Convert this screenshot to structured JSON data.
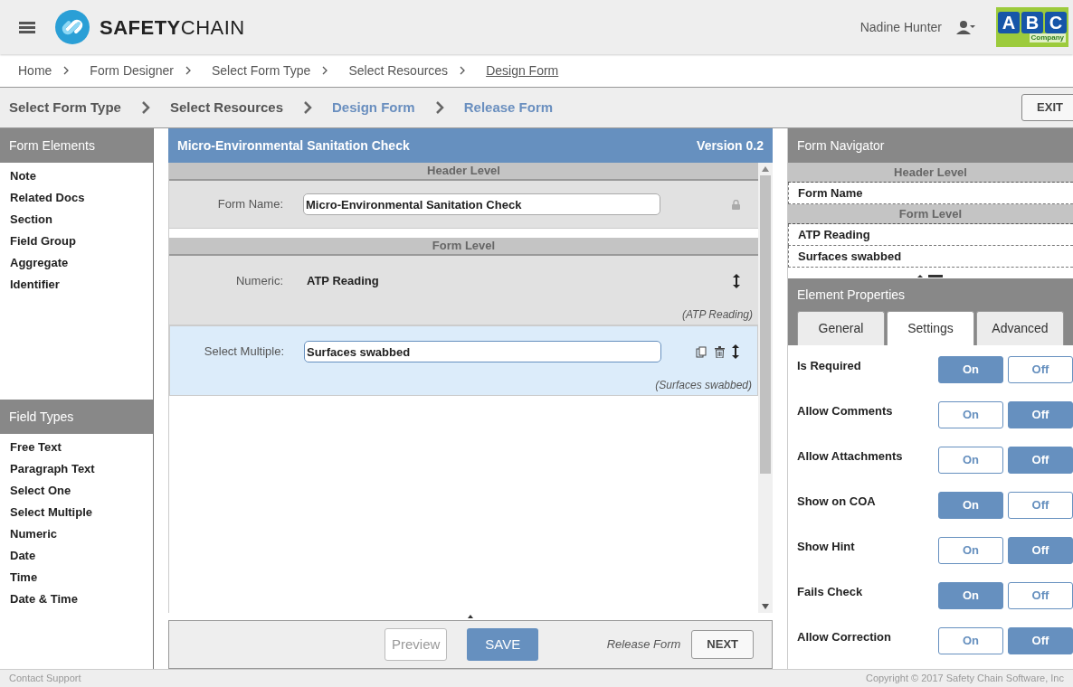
{
  "header": {
    "brand_bold": "SAFETY",
    "brand_light": "CHAIN",
    "user": "Nadine Hunter",
    "company_logo": {
      "letters": [
        "A",
        "B",
        "C"
      ],
      "caption": "Company"
    }
  },
  "breadcrumb": [
    {
      "label": "Home",
      "current": false
    },
    {
      "label": "Form Designer",
      "current": false
    },
    {
      "label": "Select Form Type",
      "current": false
    },
    {
      "label": "Select Resources",
      "current": false
    },
    {
      "label": "Design Form",
      "current": true
    }
  ],
  "wizard": {
    "steps": [
      {
        "label": "Select Form Type",
        "kind": "done"
      },
      {
        "label": "Select Resources",
        "kind": "done"
      },
      {
        "label": "Design Form",
        "kind": "upcoming"
      },
      {
        "label": "Release Form",
        "kind": "upcoming"
      }
    ],
    "exit": "EXIT"
  },
  "form_elements": {
    "title": "Form Elements",
    "items": [
      "Note",
      "Related Docs",
      "Section",
      "Field Group",
      "Aggregate",
      "Identifier"
    ]
  },
  "field_types": {
    "title": "Field Types",
    "items": [
      "Free Text",
      "Paragraph Text",
      "Select One",
      "Select Multiple",
      "Numeric",
      "Date",
      "Time",
      "Date & Time"
    ]
  },
  "form": {
    "title": "Micro-Environmental Sanitation Check",
    "version": "Version 0.2",
    "sections": [
      {
        "title": "Header Level",
        "rows": [
          {
            "label": "Form Name:",
            "kind": "input",
            "value": "Micro-Environmental Sanitation Check",
            "locked": true,
            "selected": false
          }
        ]
      },
      {
        "title": "Form Level",
        "rows": [
          {
            "label": "Numeric:",
            "kind": "text",
            "value": "ATP Reading",
            "hint": "(ATP Reading)",
            "locked": false,
            "selected": false
          },
          {
            "label": "Select Multiple:",
            "kind": "input",
            "value": "Surfaces swabbed",
            "hint": "(Surfaces swabbed)",
            "locked": false,
            "selected": true
          }
        ]
      }
    ]
  },
  "footer_bar": {
    "preview": "Preview",
    "save": "SAVE",
    "release_label": "Release Form",
    "next": "NEXT"
  },
  "navigator": {
    "title": "Form Navigator",
    "sections": [
      {
        "title": "Header Level",
        "items": [
          "Form Name"
        ]
      },
      {
        "title": "Form Level",
        "items": [
          "ATP Reading",
          "Surfaces swabbed"
        ]
      }
    ]
  },
  "properties": {
    "title": "Element Properties",
    "tabs": [
      {
        "label": "General",
        "selected": false
      },
      {
        "label": "Settings",
        "selected": true
      },
      {
        "label": "Advanced",
        "selected": false
      }
    ],
    "settings": [
      {
        "label": "Is Required",
        "on": true,
        "on_label": "On",
        "off_label": "Off"
      },
      {
        "label": "Allow Comments",
        "on": false,
        "on_label": "On",
        "off_label": "Off"
      },
      {
        "label": "Allow Attachments",
        "on": false,
        "on_label": "On",
        "off_label": "Off"
      },
      {
        "label": "Show on COA",
        "on": true,
        "on_label": "On",
        "off_label": "Off"
      },
      {
        "label": "Show Hint",
        "on": false,
        "on_label": "On",
        "off_label": "Off"
      },
      {
        "label": "Fails Check",
        "on": true,
        "on_label": "On",
        "off_label": "Off"
      },
      {
        "label": "Allow Correction",
        "on": false,
        "on_label": "On",
        "off_label": "Off"
      }
    ]
  },
  "page_footer": {
    "left": "Contact Support",
    "right": "Copyright © 2017 Safety Chain Software, Inc"
  }
}
